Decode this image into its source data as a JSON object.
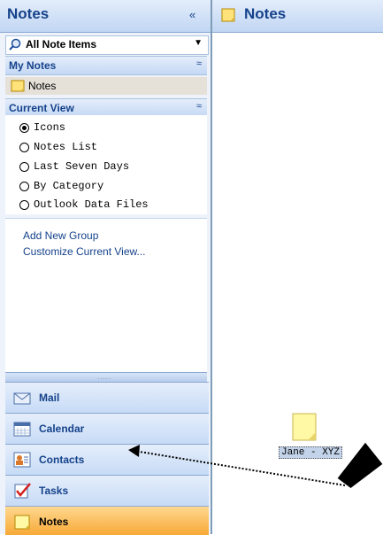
{
  "nav": {
    "title": "Notes",
    "collapse_glyph": "«",
    "filter": {
      "label": "All Note Items",
      "icon": "search-folder-icon"
    },
    "my_notes": {
      "header": "My Notes",
      "chevron": "≈",
      "items": [
        {
          "label": "Notes",
          "icon": "notes-icon"
        }
      ]
    },
    "current_view": {
      "header": "Current View",
      "chevron": "≈",
      "options": [
        {
          "label": "Icons",
          "selected": true
        },
        {
          "label": "Notes List",
          "selected": false
        },
        {
          "label": "Last Seven Days",
          "selected": false
        },
        {
          "label": "By Category",
          "selected": false
        },
        {
          "label": "Outlook Data Files",
          "selected": false
        }
      ]
    },
    "links": [
      "Add New Group",
      "Customize Current View..."
    ],
    "splitter": ".....",
    "buttons": [
      {
        "label": "Mail",
        "icon": "mail-icon"
      },
      {
        "label": "Calendar",
        "icon": "calendar-icon"
      },
      {
        "label": "Contacts",
        "icon": "contacts-icon"
      },
      {
        "label": "Tasks",
        "icon": "tasks-icon"
      },
      {
        "label": "Notes",
        "icon": "notes-icon",
        "active": true
      }
    ]
  },
  "content": {
    "title": "Notes",
    "notes": [
      {
        "label": "Jane - XYZ"
      }
    ]
  },
  "colors": {
    "accent": "#15428b",
    "active_button": "#f7a937",
    "note_yellow": "#fff9a6"
  }
}
